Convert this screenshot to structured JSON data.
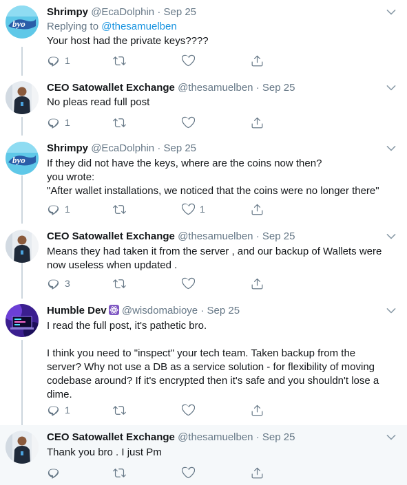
{
  "tweets": [
    {
      "name": "Shrimpy",
      "handle": "@EcaDolphin",
      "dot": "·",
      "time": "Sep 25",
      "replying_prefix": "Replying to",
      "replying_handle": "@thesamuelben",
      "lines": [
        "Your host had the private keys????"
      ],
      "reply_count": "1",
      "retweet_count": "",
      "like_count": ""
    },
    {
      "name": "CEO Satowallet Exchange",
      "handle": "@thesamuelben",
      "dot": "·",
      "time": "Sep 25",
      "lines": [
        "No pleas read full post"
      ],
      "reply_count": "1",
      "retweet_count": "",
      "like_count": ""
    },
    {
      "name": "Shrimpy",
      "handle": "@EcaDolphin",
      "dot": "·",
      "time": "Sep 25",
      "lines": [
        "If they did not have the keys, where are the coins now then?",
        "you wrote:",
        "\"After wallet installations, we noticed that the coins were no longer there\""
      ],
      "reply_count": "1",
      "retweet_count": "",
      "like_count": "1"
    },
    {
      "name": "CEO Satowallet Exchange",
      "handle": "@thesamuelben",
      "dot": "·",
      "time": "Sep 25",
      "lines": [
        "Means they had taken it from the server , and our backup of Wallets were",
        "now useless when updated ."
      ],
      "reply_count": "3",
      "retweet_count": "",
      "like_count": ""
    },
    {
      "name": "Humble Dev",
      "handle": "@wisdomabioye",
      "dot": "·",
      "time": "Sep 25",
      "lines": [
        "I read the full post, it's pathetic bro.",
        "",
        "I think you need to \"inspect\" your tech team. Taken backup from the",
        "server? Why not use a DB as a service solution - for flexibility of moving",
        "codebase around?  If it's encrypted then it's safe and you shouldn't lose a",
        "dime."
      ],
      "reply_count": "1",
      "retweet_count": "",
      "like_count": ""
    },
    {
      "name": "CEO Satowallet Exchange",
      "handle": "@thesamuelben",
      "dot": "·",
      "time": "Sep 25",
      "lines": [
        "Thank you bro . I just Pm"
      ],
      "reply_count": "",
      "retweet_count": "",
      "like_count": ""
    }
  ],
  "icons": {
    "reply": "reply-icon",
    "retweet": "retweet-icon",
    "like": "heart-icon",
    "share": "share-icon",
    "caret": "chevron-down-icon",
    "react": "react-atom-icon"
  },
  "colors": {
    "icon_gray": "#657786",
    "link_blue": "#1b95e0",
    "thread_line": "#ccd6dd",
    "highlight_bg": "#f5f8fa"
  }
}
